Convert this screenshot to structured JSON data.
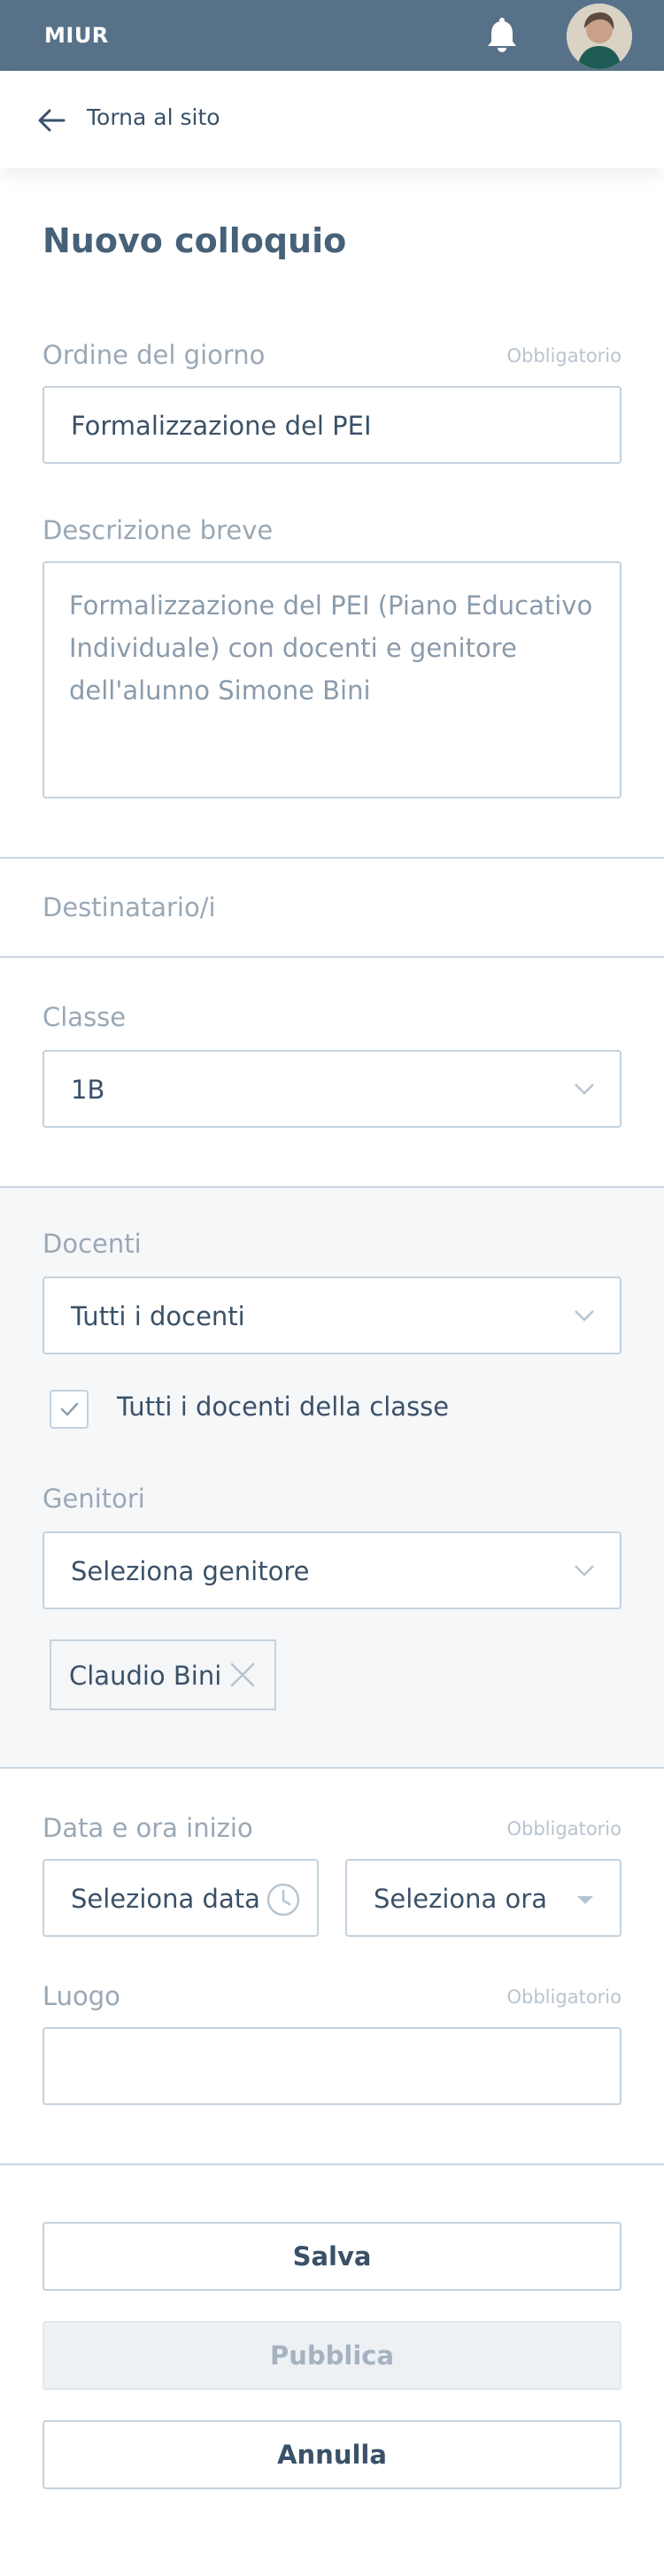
{
  "header": {
    "brand": "MIUR",
    "bell_icon": "bell-icon",
    "avatar": "user-avatar"
  },
  "nav": {
    "back_label": "Torna al sito",
    "back_icon": "arrow-left-icon"
  },
  "page": {
    "title": "Nuovo colloquio"
  },
  "form": {
    "ordine": {
      "label": "Ordine del giorno",
      "required": "Obbligatorio",
      "value": "Formalizzazione del PEI"
    },
    "descrizione": {
      "label": "Descrizione breve",
      "value": "Formalizzazione del PEI (Piano Educativo Individuale) con docenti e genitore dell'alunno Simone Bini"
    },
    "destinatari": {
      "label": "Destinatario/i"
    },
    "classe": {
      "label": "Classe",
      "value": "1B"
    },
    "docenti": {
      "label": "Docenti",
      "value": "Tutti i docenti",
      "checkbox_label": "Tutti i docenti della classe",
      "checked": true
    },
    "genitori": {
      "label": "Genitori",
      "value": "Seleziona genitore",
      "chips": [
        "Claudio Bini"
      ]
    },
    "data_ora": {
      "label": "Data e ora inizio",
      "required": "Obbligatorio",
      "date_value": "Seleziona data",
      "time_value": "Seleziona ora"
    },
    "luogo": {
      "label": "Luogo",
      "required": "Obbligatorio",
      "value": ""
    }
  },
  "actions": {
    "save": "Salva",
    "publish": "Pubblica",
    "cancel": "Annulla"
  },
  "colors": {
    "header_bg": "#577189",
    "text": "#3a5168",
    "label": "#9aa8b6",
    "border": "#c4d2de",
    "section_bg": "#f6f7f9"
  }
}
